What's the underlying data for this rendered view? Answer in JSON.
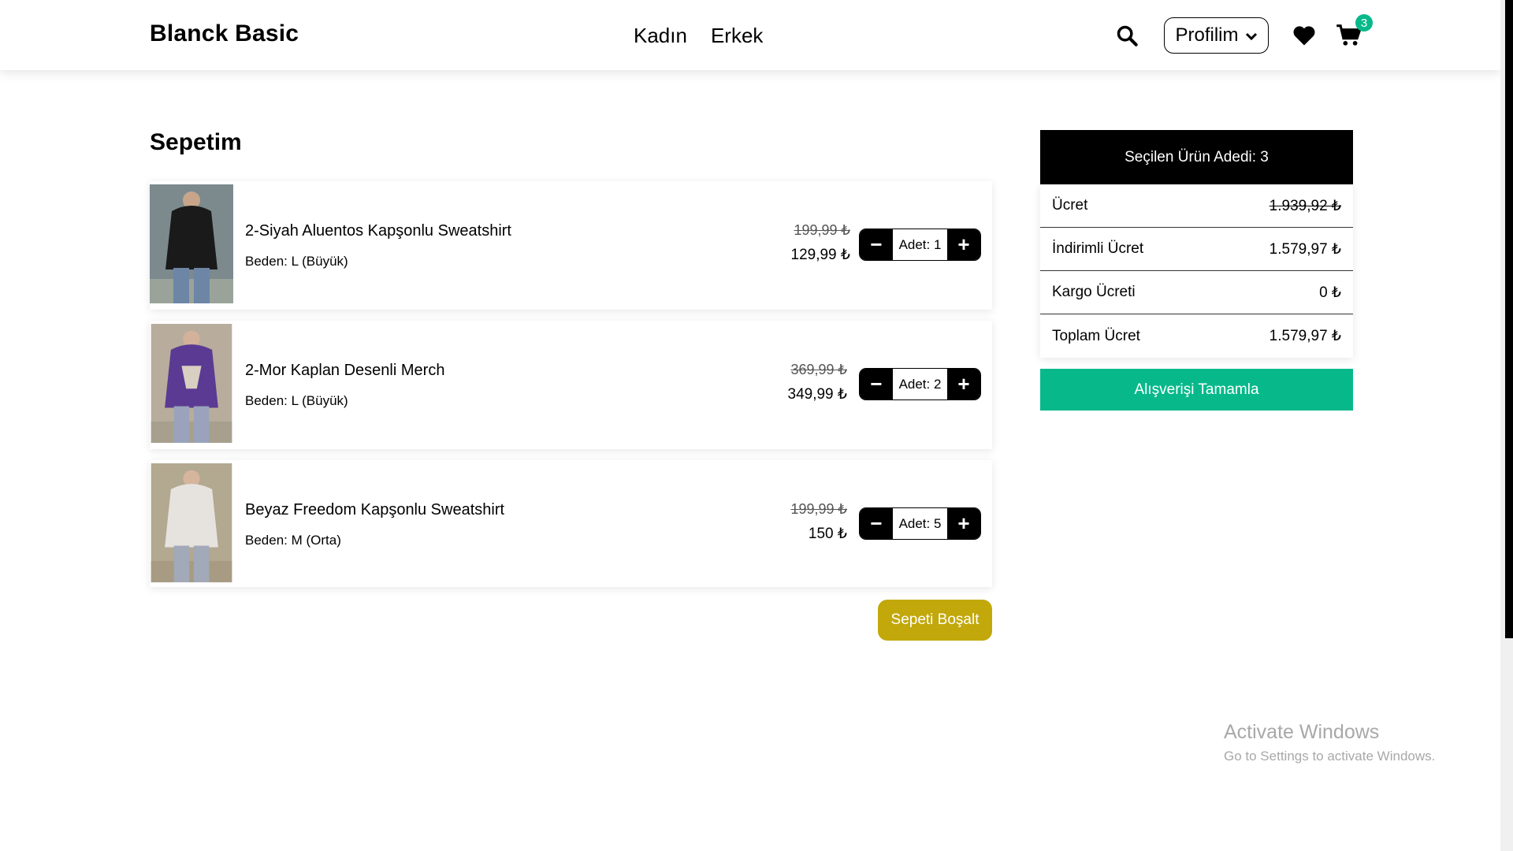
{
  "header": {
    "brand": "Blanck Basic",
    "nav": [
      "Kadın",
      "Erkek"
    ],
    "profile_label": "Profilim",
    "cart_count": "3",
    "icons": [
      "search-icon",
      "chevron-down-icon",
      "heart-icon",
      "cart-icon"
    ]
  },
  "cart": {
    "title": "Sepetim",
    "items": [
      {
        "name": "2-Siyah Aluentos Kapşonlu Sweatshirt",
        "size": "Beden: L (Büyük)",
        "old_price": "199,99 ₺",
        "new_price": "129,99 ₺",
        "qty": "Adet: 1",
        "image_color": "#1a1a1a"
      },
      {
        "name": "2-Mor Kaplan Desenli Merch",
        "size": "Beden: L (Büyük)",
        "old_price": "369,99 ₺",
        "new_price": "349,99 ₺",
        "qty": "Adet: 2",
        "image_color": "#5b3a93"
      },
      {
        "name": "Beyaz Freedom Kapşonlu Sweatshirt",
        "size": "Beden: M (Orta)",
        "old_price": "199,99 ₺",
        "new_price": "150 ₺",
        "qty": "Adet: 5",
        "image_color": "#e6e3df"
      }
    ],
    "empty_label": "Sepeti Boşalt"
  },
  "summary": {
    "header": "Seçilen Ürün Adedi: 3",
    "rows": [
      {
        "label": "Ücret",
        "value": "1.939,92 ₺"
      },
      {
        "label": "İndirimli Ücret",
        "value": "1.579,97 ₺"
      },
      {
        "label": "Kargo Ücreti",
        "value": "0 ₺"
      },
      {
        "label": "Toplam Ücret",
        "value": "1.579,97 ₺"
      }
    ],
    "checkout_label": "Alışverişi Tamamla"
  },
  "watermark": {
    "title": "Activate Windows",
    "subtitle": "Go to Settings to activate Windows."
  },
  "colors": {
    "accent_green": "#07b98a",
    "accent_gold": "#c2a80a"
  }
}
